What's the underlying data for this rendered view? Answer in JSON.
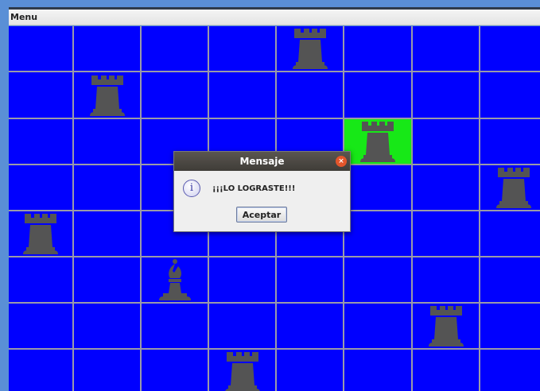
{
  "menubar": {
    "menu_label": "Menu"
  },
  "board": {
    "rows": 8,
    "cols": 8,
    "cell_color": "#0000ff",
    "highlight_color": "#17e817",
    "grid_color": "#9a9aa8",
    "piece_color": "#545454",
    "highlight": {
      "row": 2,
      "col": 5
    },
    "pieces": [
      {
        "type": "rook",
        "row": 0,
        "col": 4
      },
      {
        "type": "rook",
        "row": 1,
        "col": 1
      },
      {
        "type": "rook",
        "row": 2,
        "col": 5
      },
      {
        "type": "rook",
        "row": 3,
        "col": 7
      },
      {
        "type": "rook",
        "row": 4,
        "col": 0
      },
      {
        "type": "bishop",
        "row": 5,
        "col": 2
      },
      {
        "type": "rook",
        "row": 6,
        "col": 6
      },
      {
        "type": "rook",
        "row": 7,
        "col": 3
      }
    ]
  },
  "dialog": {
    "title": "Mensaje",
    "close_glyph": "×",
    "icon": "info-icon",
    "icon_glyph": "i",
    "message": "¡¡¡LO LOGRASTE!!!",
    "ok_label": "Aceptar"
  }
}
